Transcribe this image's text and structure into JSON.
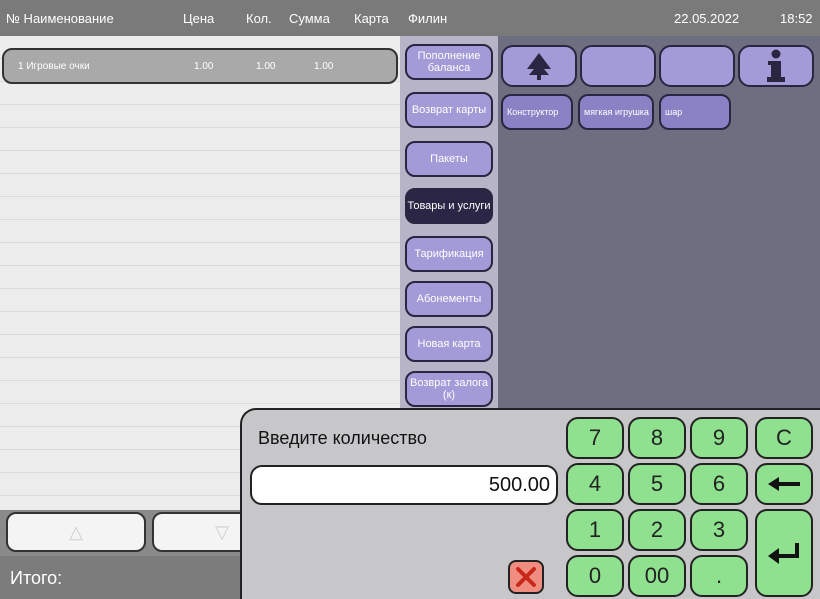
{
  "header": {
    "col_num_name": "№ Наименование",
    "col_price": "Цена",
    "col_qty": "Кол.",
    "col_sum": "Сумма",
    "col_card": "Карта",
    "branch": "Филин",
    "date": "22.05.2022",
    "time": "18:52"
  },
  "order": {
    "rows": [
      {
        "num_name": "1 Игровые очки",
        "price": "1.00",
        "qty": "1.00",
        "sum": "1.00"
      }
    ],
    "total_label": "Итого:"
  },
  "categories": [
    {
      "label": "Пополнение баланса"
    },
    {
      "label": "Возврат карты"
    },
    {
      "label": "Пакеты"
    },
    {
      "label": "Товары и услуги"
    },
    {
      "label": "Тарификация"
    },
    {
      "label": "Абонементы"
    },
    {
      "label": "Новая карта"
    },
    {
      "label": "Возврат залога (к)"
    }
  ],
  "toolbar": {
    "up_icon": "tree-up-icon",
    "info_icon": "info-icon"
  },
  "items": [
    {
      "label": "Конструктор"
    },
    {
      "label": "мягкая игрушка"
    },
    {
      "label": "шар"
    }
  ],
  "numpad": {
    "prompt": "Введите количество",
    "value": "500.00",
    "keys": [
      "7",
      "8",
      "9",
      "C",
      "4",
      "5",
      "6",
      "1",
      "2",
      "3",
      "0",
      "00",
      "."
    ],
    "backspace_icon": "backspace-arrow-icon",
    "enter_icon": "enter-icon",
    "cancel_icon": "cancel-x-icon"
  },
  "colors": {
    "accent_purple": "#a39ad8",
    "key_green": "#8fe08f",
    "cancel_red": "#f08d80"
  }
}
